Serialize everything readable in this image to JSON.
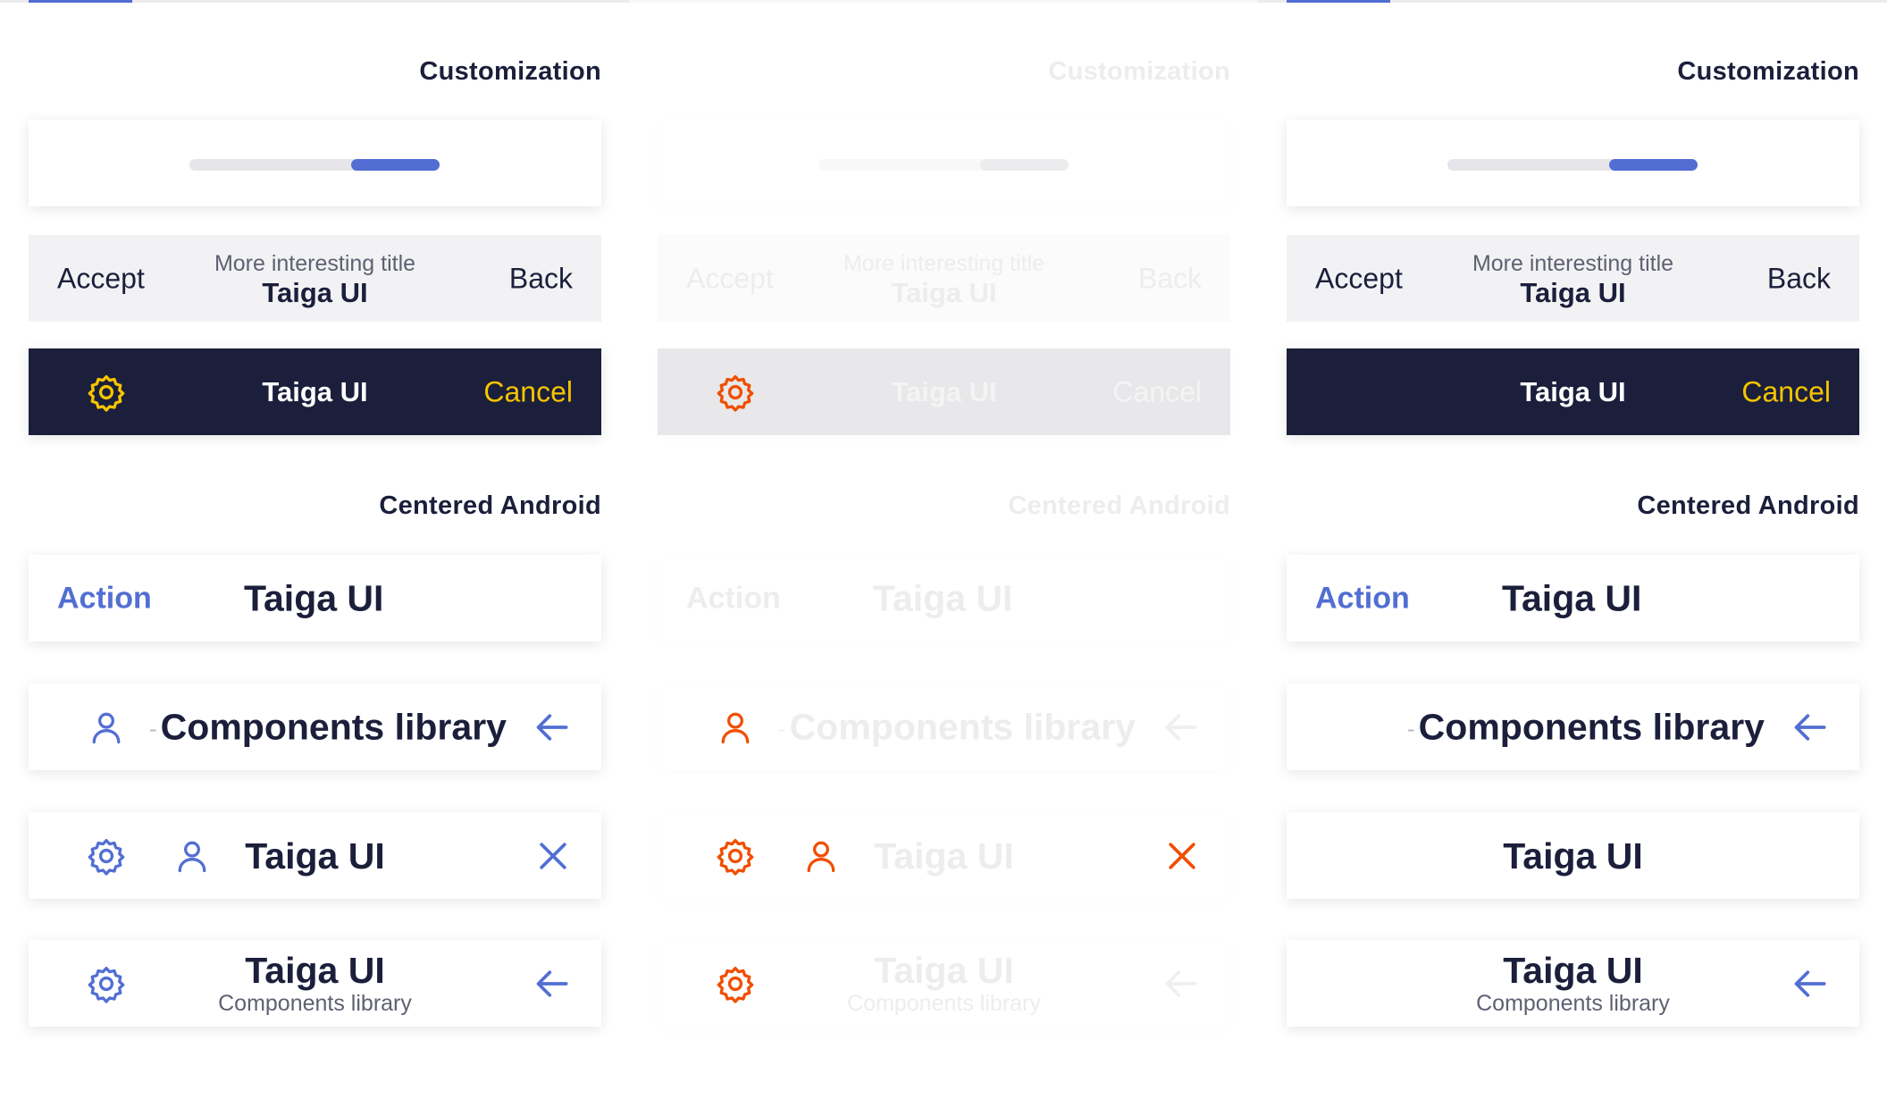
{
  "colors": {
    "accent": "#526ed3",
    "dark_navy": "#1b1f3b",
    "yellow": "#f5c400",
    "orange_red": "#f04e00",
    "dark_text": "#1b1f3b",
    "muted_text": "#5e6172"
  },
  "sections": {
    "customization": "Customization",
    "centered_android": "Centered Android"
  },
  "customization": {
    "accept_label": "Accept",
    "back_label": "Back",
    "subtitle": "More interesting title",
    "title": "Taiga UI",
    "dark_title": "Taiga UI",
    "cancel_label": "Cancel"
  },
  "android": {
    "action_label": "Action",
    "title": "Taiga UI",
    "library_title": "Components library",
    "icon_title": "Taiga UI",
    "two_line_title": "Taiga UI",
    "two_line_subtitle": "Components library"
  },
  "icons": {
    "settings": "gear-icon",
    "user": "user-icon",
    "back": "arrow-left-icon",
    "close": "close-icon"
  }
}
